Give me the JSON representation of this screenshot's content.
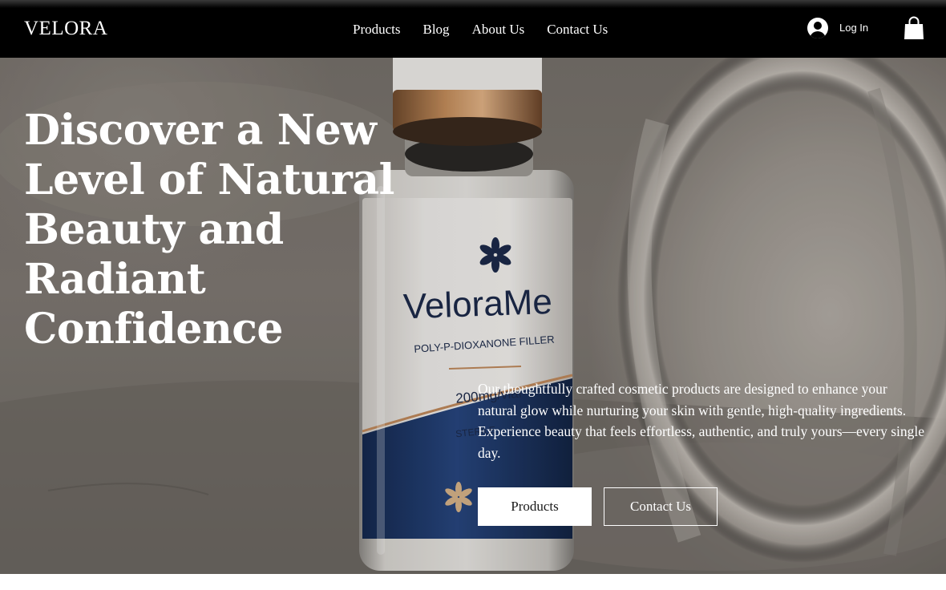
{
  "header": {
    "logo": "VELORA",
    "nav": [
      "Products",
      "Blog",
      "About Us",
      "Contact Us"
    ],
    "login_label": "Log In"
  },
  "hero": {
    "title": "Discover a New Level of Natural Beauty and Radiant Confidence",
    "description": "Our thoughtfully crafted cosmetic products are designed to enhance your natural glow while nurturing your skin with gentle, high-quality ingredients. Experience beauty that feels effortless, authentic, and truly yours—every single day.",
    "primary_button": "Products",
    "secondary_button": "Contact Us",
    "product_label": {
      "brand": "VeloraMe",
      "product_name": "POLY-P-DIOXANONE FILLER",
      "dose": "200mg/vial",
      "sterile": "STERILE"
    }
  },
  "colors": {
    "header_bg": "#000000",
    "vial_blue": "#1f3f78",
    "cap_bronze": "#b07a4a",
    "label_ink": "#1c2a4a"
  }
}
